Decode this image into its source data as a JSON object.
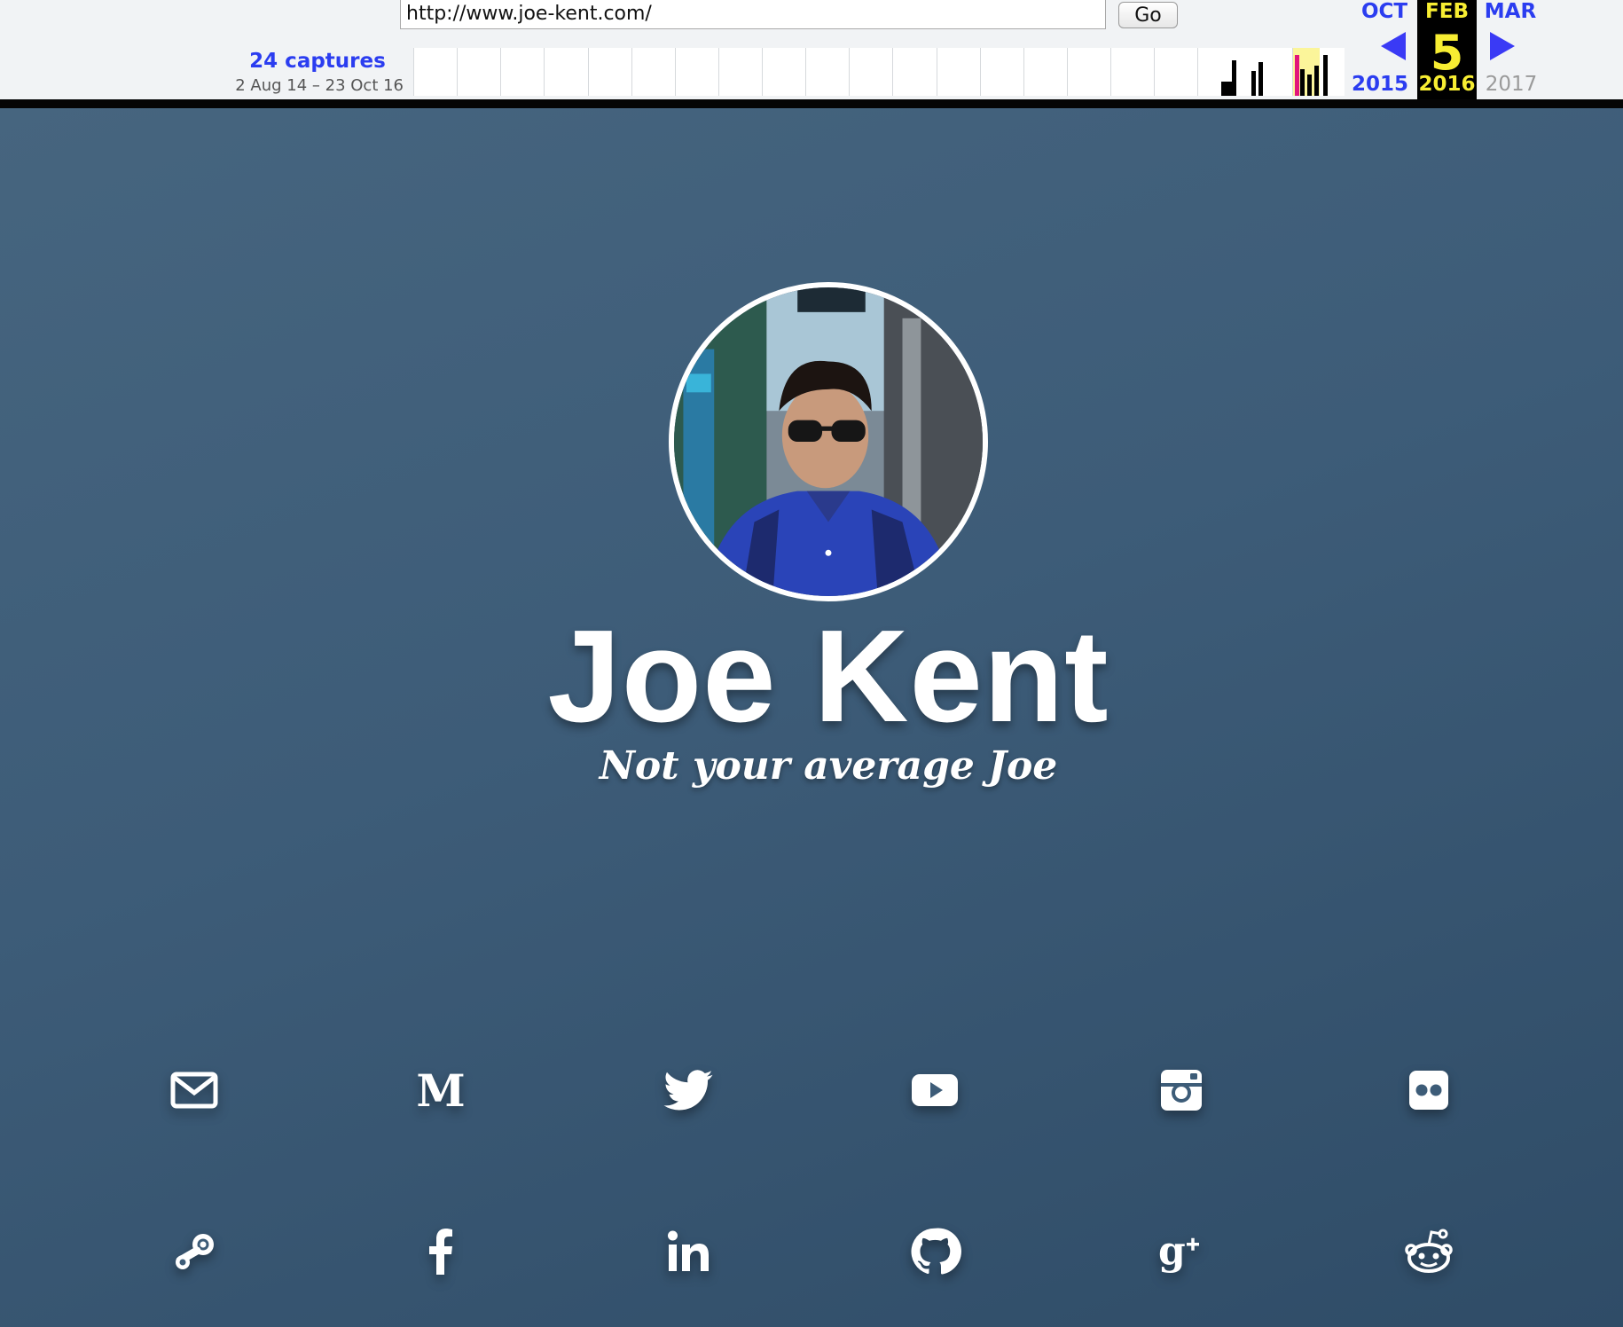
{
  "wayback": {
    "url": "http://www.joe-kent.com/",
    "go_label": "Go",
    "captures": "24 captures",
    "date_range": "2 Aug 14 – 23 Oct 16",
    "prev_month": "OCT",
    "cur_month": "FEB",
    "next_month": "MAR",
    "cur_day": "5",
    "prev_year": "2015",
    "cur_year": "2016",
    "next_year": "2017",
    "colors": {
      "link_blue": "#2b3df0",
      "current_year_yellow": "#f7ed32",
      "disabled_gray": "#9a9a9a"
    }
  },
  "profile": {
    "name": "Joe Kent",
    "tagline": "Not your average Joe",
    "avatar_icon": "profile-photo"
  },
  "social": {
    "row1": [
      {
        "icon": "envelope-icon"
      },
      {
        "icon": "medium-icon"
      },
      {
        "icon": "twitter-icon"
      },
      {
        "icon": "youtube-icon"
      },
      {
        "icon": "instagram-icon"
      },
      {
        "icon": "flickr-icon"
      }
    ],
    "row2": [
      {
        "icon": "steam-icon"
      },
      {
        "icon": "facebook-icon"
      },
      {
        "icon": "linkedin-icon"
      },
      {
        "icon": "github-icon"
      },
      {
        "icon": "google-plus-icon"
      },
      {
        "icon": "reddit-icon"
      }
    ]
  },
  "colors": {
    "page_background": "#3d5d79",
    "text": "#ffffff"
  }
}
